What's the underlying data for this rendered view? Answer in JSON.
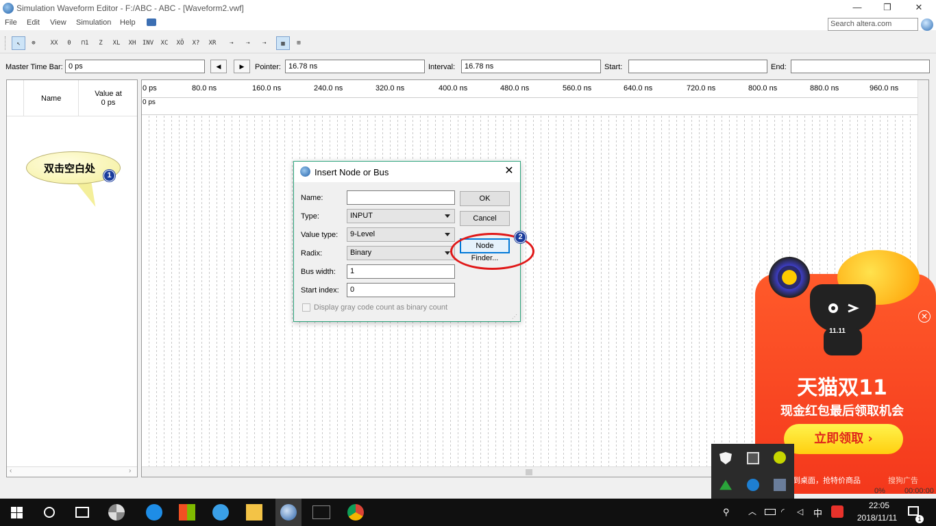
{
  "window": {
    "title": "Simulation Waveform Editor - F:/ABC - ABC - [Waveform2.vwf]",
    "minimize": "—",
    "restore": "❐",
    "close": "✕"
  },
  "menu": [
    "File",
    "Edit",
    "View",
    "Simulation",
    "Help"
  ],
  "search": {
    "placeholder": "Search altera.com"
  },
  "toolbar": {
    "icons": [
      "pointer-tool-icon",
      "zoom-tool-icon",
      "force-unknown-icon",
      "force-low-icon",
      "force-high-icon",
      "force-high-impedance-icon",
      "force-weak-unknown-icon",
      "force-weak-low-icon",
      "force-weak-high-icon",
      "invert-icon",
      "count-value-icon",
      "force-clock-icon",
      "random-values-icon",
      "dont-care-icon",
      "arbitrary-value-icon",
      "snap-to-grid-icon",
      "snap-to-transition-icon",
      "find-icon",
      "waveform-view-icon",
      "grid-view-icon"
    ]
  },
  "timebar": {
    "master_label": "Master Time Bar:",
    "master_value": "0 ps",
    "prev": "◀",
    "next": "▶",
    "pointer_label": "Pointer:",
    "pointer_value": "16.78 ns",
    "interval_label": "Interval:",
    "interval_value": "16.78 ns",
    "start_label": "Start:",
    "start_value": "",
    "end_label": "End:",
    "end_value": ""
  },
  "name_panel": {
    "name_header": "Name",
    "value_header_1": "Value at",
    "value_header_2": "0 ps"
  },
  "ruler": {
    "ticks": [
      "0 ps",
      "80.0 ns",
      "160.0 ns",
      "240.0 ns",
      "320.0 ns",
      "400.0 ns",
      "480.0 ns",
      "560.0 ns",
      "640.0 ns",
      "720.0 ns",
      "800.0 ns",
      "880.0 ns",
      "960.0 ns"
    ],
    "cursor_label": "0 ps"
  },
  "annotation": {
    "callout_text": "双击空白处",
    "step1": "1",
    "step2": "2"
  },
  "dialog": {
    "title": "Insert Node or Bus",
    "close": "✕",
    "name_label": "Name:",
    "name_value": "",
    "type_label": "Type:",
    "type_value": "INPUT",
    "value_type_label": "Value type:",
    "value_type_value": "9-Level",
    "radix_label": "Radix:",
    "radix_value": "Binary",
    "bus_width_label": "Bus width:",
    "bus_width_value": "1",
    "start_index_label": "Start index:",
    "start_index_value": "0",
    "gray_code_label": "Display gray code count as binary count",
    "ok": "OK",
    "cancel": "Cancel",
    "node_finder": "Node Finder..."
  },
  "ad": {
    "badge": "11.11",
    "title": "天猫双11",
    "subtitle": "现金红包最后领取机会",
    "cta": "立即领取 ›",
    "bottom": "到桌面，抢特价商品",
    "brand": "搜狗广告",
    "close": "✕"
  },
  "status": {
    "progress": "0%",
    "time": "00:00:00"
  },
  "taskbar": {
    "time": "22:05",
    "date": "2018/11/11",
    "ime": "中",
    "notifications": "1"
  }
}
